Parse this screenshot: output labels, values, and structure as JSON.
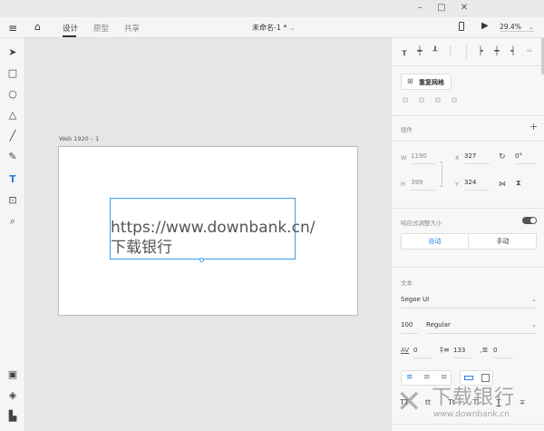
{
  "window": {
    "minimize": "–",
    "maximize": "□",
    "close": "✕"
  },
  "topbar": {
    "menu_icon": "hamburger-icon",
    "home_icon": "home-icon",
    "tabs": [
      {
        "label": "设计",
        "active": true
      },
      {
        "label": "原型"
      },
      {
        "label": "共享"
      }
    ],
    "doc_title": "未命名-1 *",
    "zoom": "29.4%"
  },
  "tools": [
    "select",
    "rectangle",
    "ellipse",
    "triangle",
    "line",
    "pen",
    "text",
    "artboard",
    "zoom"
  ],
  "bottom_tools": [
    "plugins",
    "layers",
    "assets"
  ],
  "canvas": {
    "artboard_label": "Web 1920 – 1",
    "text_line1": "https://www.downbank.cn/",
    "text_line2": "下载银行"
  },
  "panel": {
    "repeat_grid": "重复网格",
    "components_label": "组件",
    "add": "+",
    "w_label": "W",
    "w": "1190",
    "h_label": "H",
    "h": "399",
    "x_label": "X",
    "x": "327",
    "y_label": "Y",
    "y": "324",
    "rotation": "0°",
    "responsive_label": "响应式调整大小",
    "responsive_on": true,
    "auto": "自动",
    "manual": "手动",
    "text_label": "文本",
    "font": "Segoe UI",
    "size": "100",
    "weight": "Regular",
    "char_spacing": "0",
    "line_spacing": "133",
    "para_spacing": "0",
    "accent": "#2680eb"
  },
  "watermark": {
    "text": "下载银行",
    "url": "www.downbank.cn"
  }
}
